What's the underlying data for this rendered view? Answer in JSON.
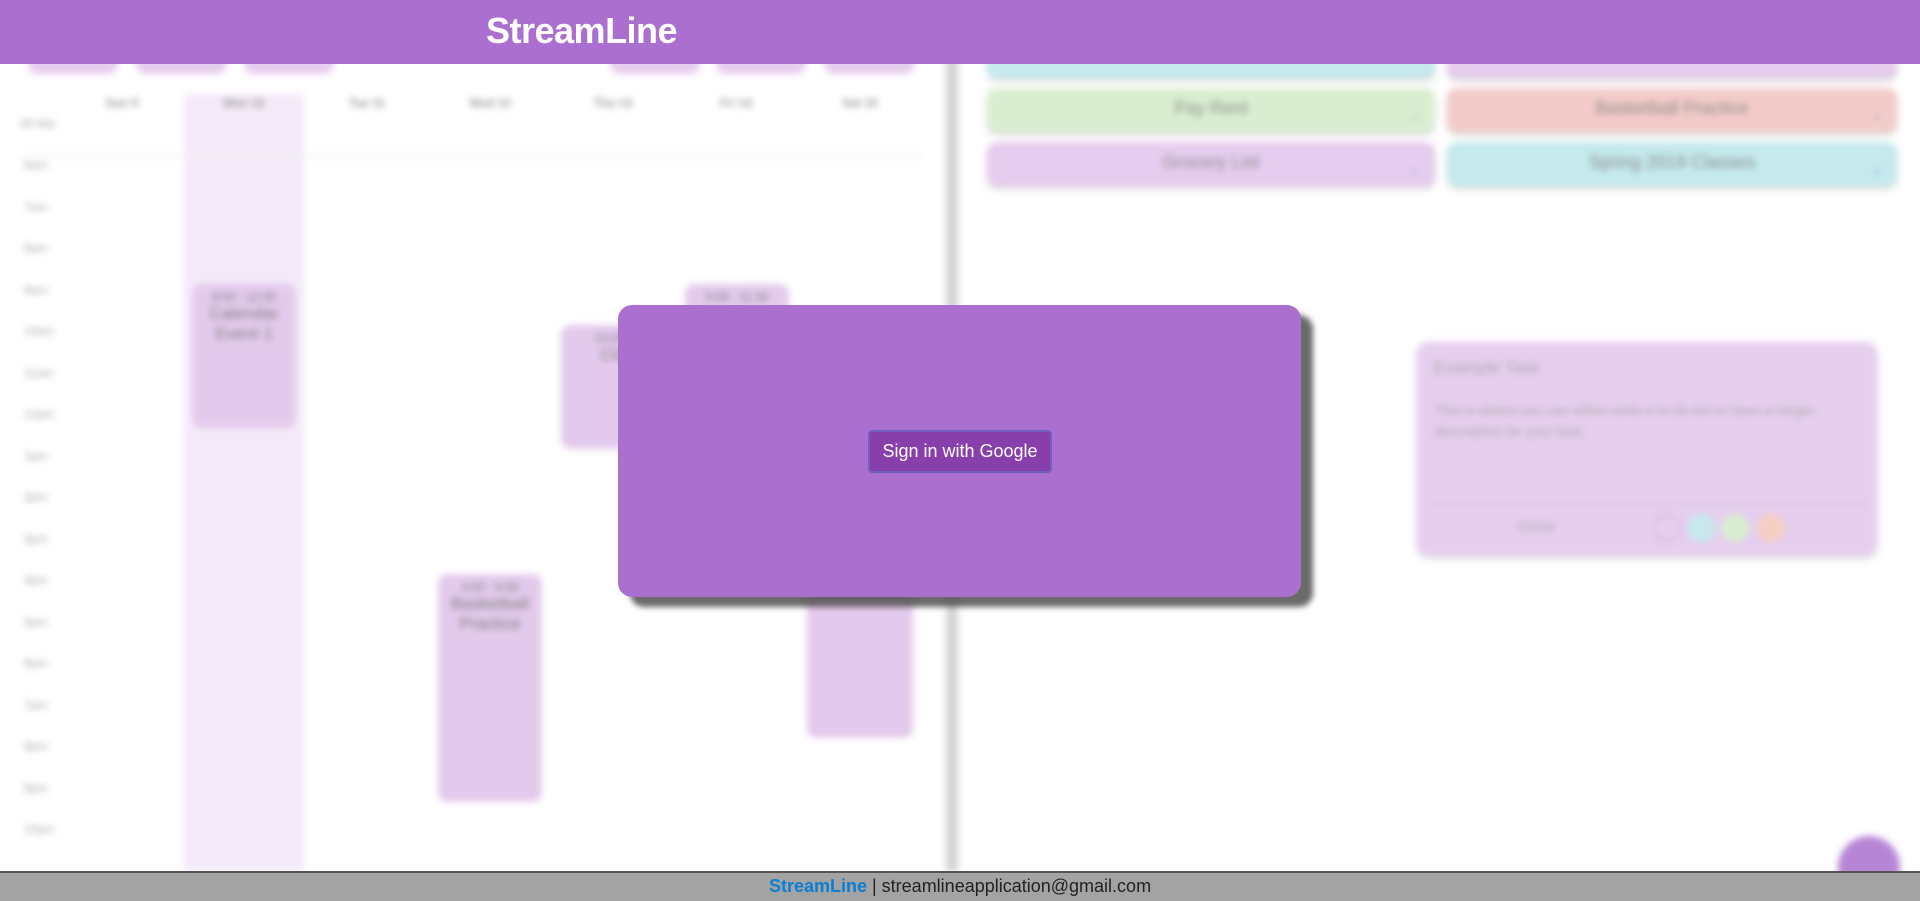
{
  "app": {
    "title": "StreamLine"
  },
  "calendar": {
    "all_day_label": "all-day",
    "days": [
      "Sun 9",
      "Mon 10",
      "Tue 11",
      "Wed 12",
      "Thu 13",
      "Fri 14",
      "Sat 15"
    ],
    "hours": [
      "6am",
      "7am",
      "8am",
      "9am",
      "10am",
      "11am",
      "12pm",
      "1pm",
      "2pm",
      "3pm",
      "4pm",
      "5pm",
      "6pm",
      "7pm",
      "8pm",
      "9pm",
      "10pm"
    ],
    "events": [
      {
        "time": "9:00 - 12:30",
        "name": "Calendar Event 1"
      },
      {
        "time": "10:00 -",
        "name": "Cla"
      },
      {
        "time": "9:00 - 11:30",
        "name": ""
      },
      {
        "time": "4:00 - 9:30",
        "name": "Basketball Practice"
      }
    ]
  },
  "lists": [
    {
      "label": "Pay Rent",
      "color": "#d3ecc9"
    },
    {
      "label": "Basketball Practice",
      "color": "#f1c3c0"
    },
    {
      "label": "Grocery List",
      "color": "#e2c4ec"
    },
    {
      "label": "Spring 2019 Classes",
      "color": "#bbe6ea"
    }
  ],
  "task_card": {
    "title": "Example Task",
    "description": "This is where you can either write a to-do list or have a longer description for your task.",
    "close_label": "Close",
    "colors": [
      "#e3c6ec",
      "#bbe6ea",
      "#d3ecc9",
      "#f5c7b8"
    ]
  },
  "modal": {
    "signin_label": "Sign in with Google"
  },
  "footer": {
    "brand": "StreamLine",
    "separator": " | ",
    "email": "streamlineapplication@gmail.com"
  }
}
